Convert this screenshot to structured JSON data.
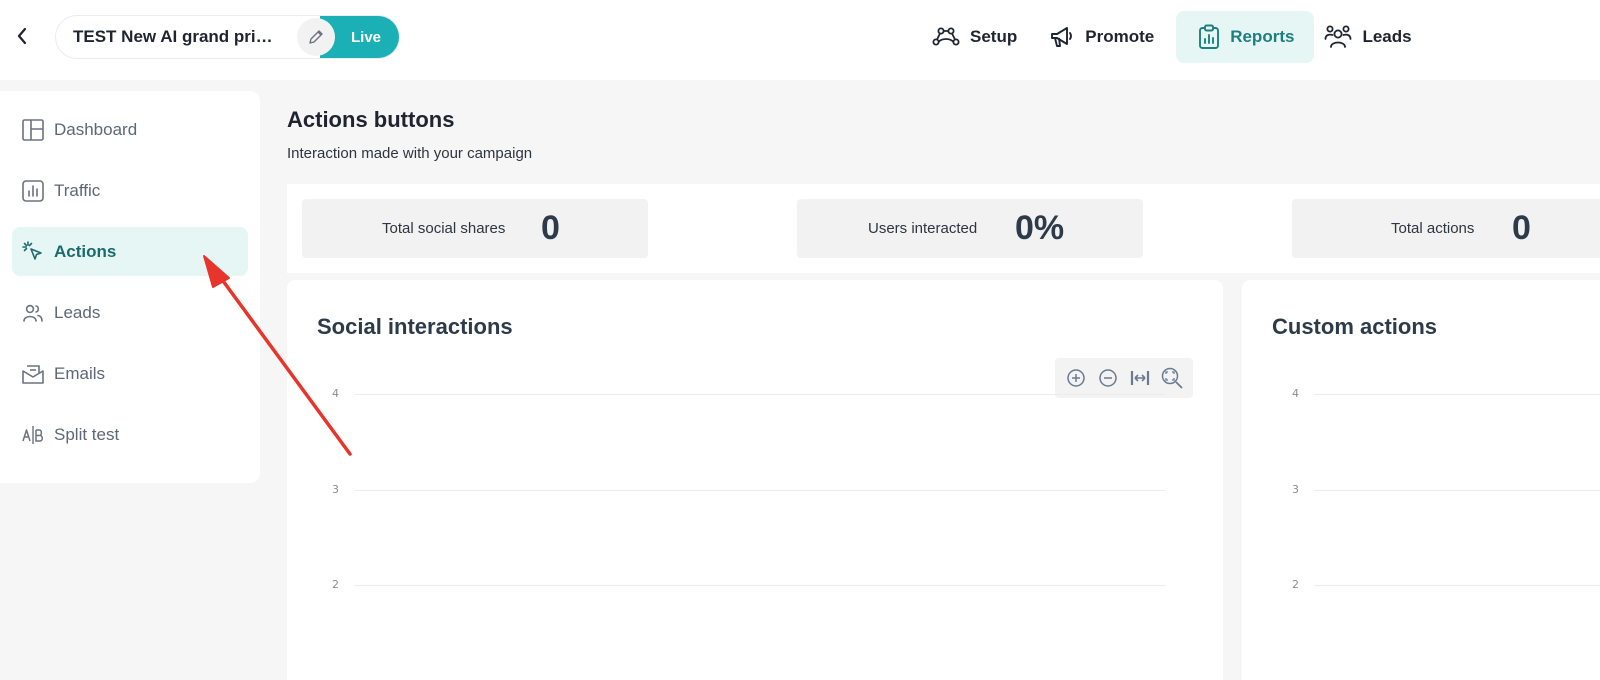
{
  "header": {
    "campaign_title": "TEST New AI grand pri…",
    "status_badge": "Live",
    "nav": [
      {
        "label": "Setup",
        "icon": "setup-icon"
      },
      {
        "label": "Promote",
        "icon": "megaphone-icon"
      },
      {
        "label": "Reports",
        "icon": "clipboard-chart-icon",
        "active": true
      },
      {
        "label": "Leads",
        "icon": "users-icon"
      }
    ]
  },
  "sidebar": {
    "items": [
      {
        "label": "Dashboard",
        "icon": "layout-icon"
      },
      {
        "label": "Traffic",
        "icon": "bar-chart-icon"
      },
      {
        "label": "Actions",
        "icon": "cursor-click-icon",
        "active": true
      },
      {
        "label": "Leads",
        "icon": "users-icon"
      },
      {
        "label": "Emails",
        "icon": "mail-icon"
      },
      {
        "label": "Split test",
        "icon": "ab-test-icon"
      }
    ]
  },
  "main": {
    "title": "Actions buttons",
    "subtitle": "Interaction made with your campaign",
    "stats": [
      {
        "label": "Total social shares",
        "value": "0"
      },
      {
        "label": "Users interacted",
        "value": "0%"
      },
      {
        "label": "Total actions",
        "value": "0"
      }
    ],
    "panels": [
      {
        "title": "Social interactions"
      },
      {
        "title": "Custom actions"
      }
    ]
  },
  "chart_data": [
    {
      "type": "line",
      "title": "Social interactions",
      "y_ticks": [
        "4",
        "3",
        "2"
      ],
      "series": [],
      "grid": true
    },
    {
      "type": "line",
      "title": "Custom actions",
      "y_ticks": [
        "4",
        "3",
        "2"
      ],
      "series": [],
      "grid": true
    }
  ],
  "colors": {
    "accent": "#1ab0b5",
    "active_bg": "#e6f6f5",
    "active_text": "#1d7f80",
    "annotation_arrow": "#e8352b"
  }
}
